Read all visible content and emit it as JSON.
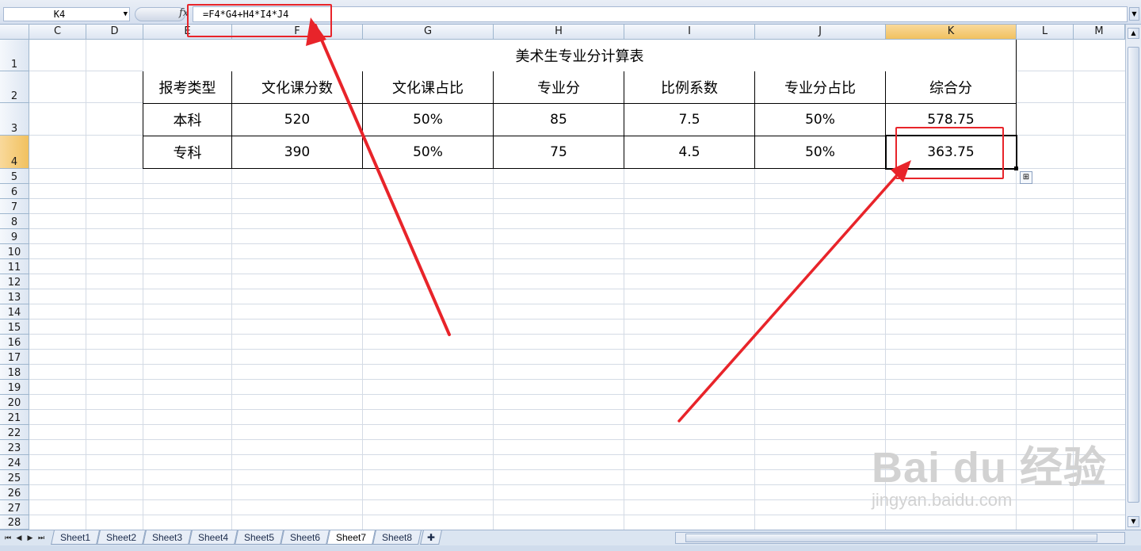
{
  "formula_bar": {
    "name_box": "K4",
    "fx_label": "fx",
    "formula": "=F4*G4+H4*I4*J4"
  },
  "columns": [
    "C",
    "D",
    "E",
    "F",
    "G",
    "H",
    "I",
    "J",
    "K",
    "L",
    "M"
  ],
  "selected_column": "K",
  "rows": [
    "1",
    "2",
    "3",
    "4",
    "5",
    "6",
    "7",
    "8",
    "9",
    "10",
    "11",
    "12",
    "13",
    "14",
    "15",
    "16",
    "17",
    "18",
    "19",
    "20",
    "21",
    "22",
    "23",
    "24",
    "25",
    "26",
    "27",
    "28"
  ],
  "selected_row": "4",
  "table": {
    "title": "美术生专业分计算表",
    "headers": [
      "报考类型",
      "文化课分数",
      "文化课占比",
      "专业分",
      "比例系数",
      "专业分占比",
      "综合分"
    ],
    "rows": [
      [
        "本科",
        "520",
        "50%",
        "85",
        "7.5",
        "50%",
        "578.75"
      ],
      [
        "专科",
        "390",
        "50%",
        "75",
        "4.5",
        "50%",
        "363.75"
      ]
    ]
  },
  "sheet_tabs": [
    "Sheet1",
    "Sheet2",
    "Sheet3",
    "Sheet4",
    "Sheet5",
    "Sheet6",
    "Sheet7",
    "Sheet8"
  ],
  "active_sheet": "Sheet7",
  "watermark": {
    "logo_text": "Bai du 经验",
    "url": "jingyan.baidu.com"
  },
  "colors": {
    "annotation_red": "#e8242a",
    "header_selected": "#f1c15f",
    "gridline": "#d4dbe5"
  }
}
